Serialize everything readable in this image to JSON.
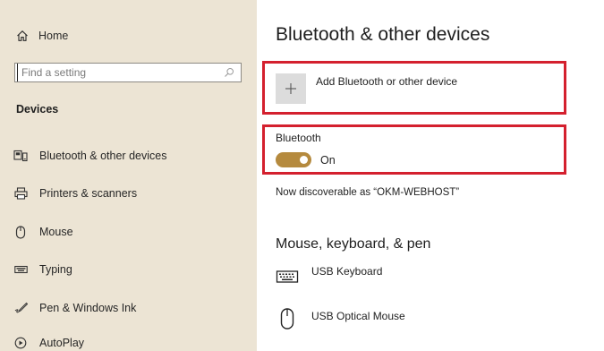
{
  "sidebar": {
    "home_label": "Home",
    "search_placeholder": "Find a setting",
    "section_heading": "Devices",
    "items": [
      {
        "label": "Bluetooth & other devices",
        "icon": "bluetooth-devices-icon"
      },
      {
        "label": "Printers & scanners",
        "icon": "printer-icon"
      },
      {
        "label": "Mouse",
        "icon": "mouse-icon"
      },
      {
        "label": "Typing",
        "icon": "keyboard-icon"
      },
      {
        "label": "Pen & Windows Ink",
        "icon": "pen-icon"
      },
      {
        "label": "AutoPlay",
        "icon": "autoplay-icon"
      }
    ]
  },
  "main": {
    "title": "Bluetooth & other devices",
    "add_device_label": "Add Bluetooth or other device",
    "bluetooth_label": "Bluetooth",
    "bluetooth_state": "On",
    "discoverable_text": "Now discoverable as “OKM-WEBHOST”",
    "section_title": "Mouse, keyboard, & pen",
    "devices": [
      {
        "name": "USB Keyboard",
        "icon": "keyboard-icon"
      },
      {
        "name": "USB Optical Mouse",
        "icon": "mouse-icon"
      }
    ]
  },
  "colors": {
    "sidebar_bg": "#ece4d4",
    "toggle_accent": "#b58a3e",
    "highlight_red": "#d4202e"
  }
}
